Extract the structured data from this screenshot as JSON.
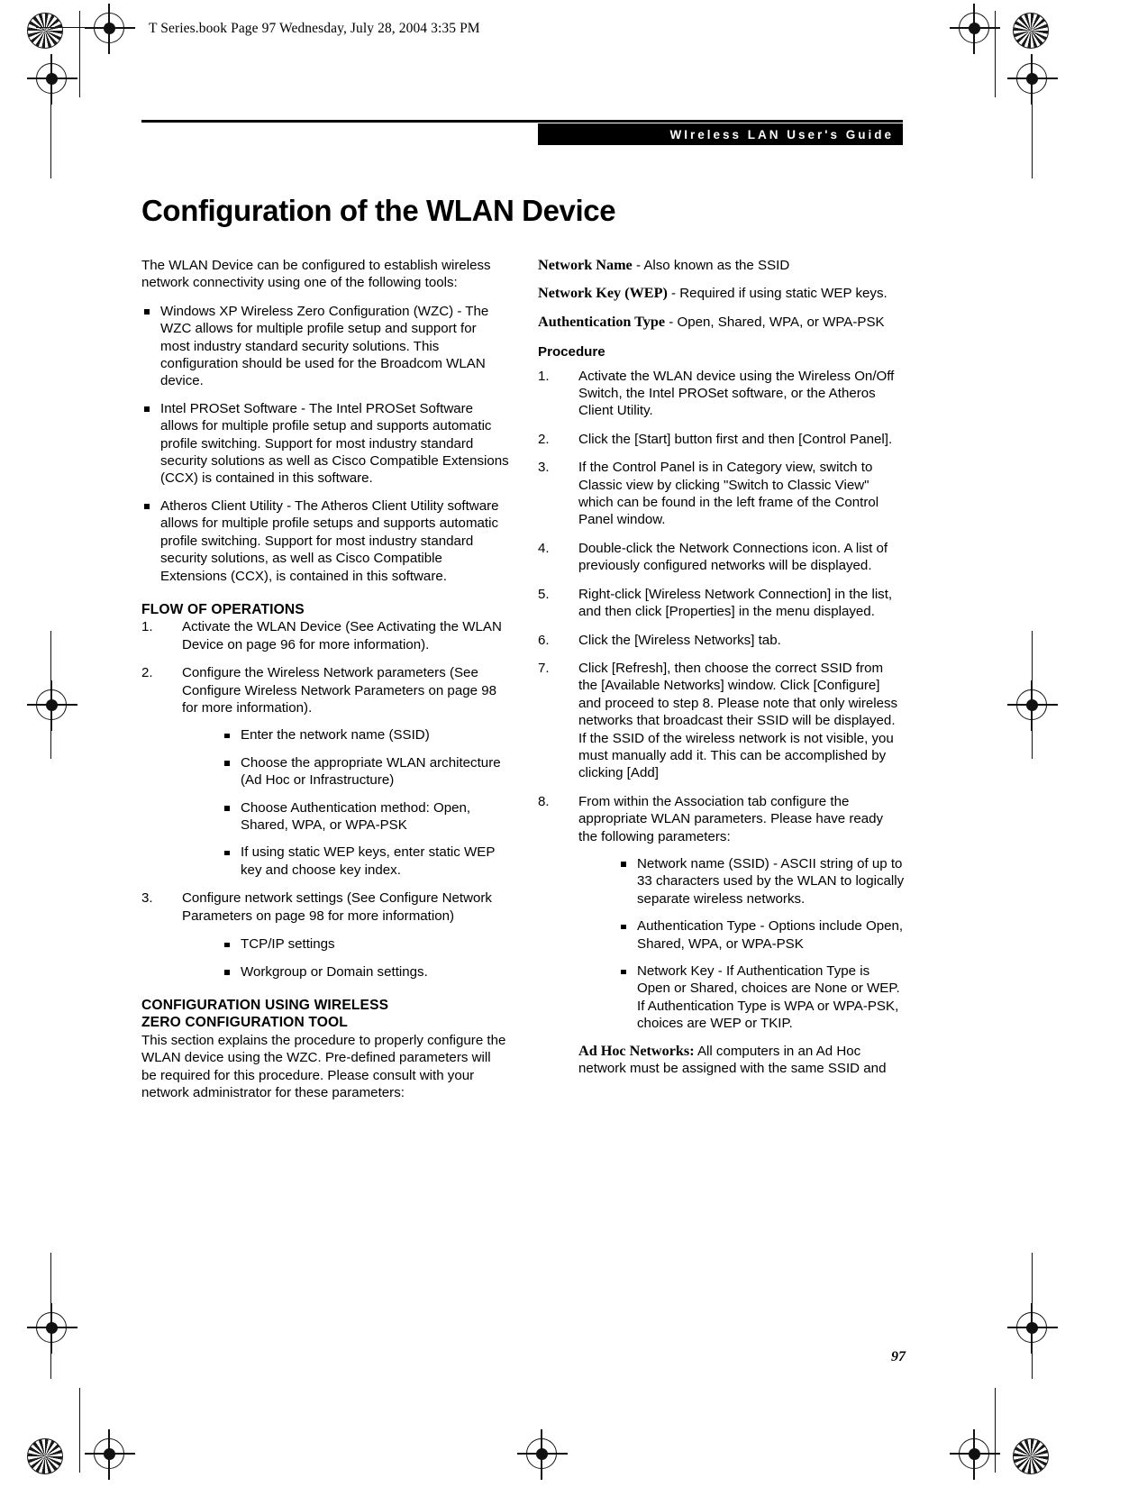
{
  "running_head": "T Series.book  Page 97  Wednesday, July 28, 2004  3:35 PM",
  "banner": {
    "label": "WIreless LAN User's Guide"
  },
  "page_title": "Configuration of the WLAN Device",
  "page_number": "97",
  "left_column": {
    "intro": "The WLAN Device can be configured to establish wireless network connectivity using one of the following tools:",
    "tool_bullets": [
      "Windows XP Wireless Zero Configuration (WZC) - The WZC allows for multiple profile setup and support for most industry standard security solutions. This configuration should be used for the Broadcom WLAN device.",
      "Intel PROSet Software - The Intel PROSet Software allows for multiple profile setup and supports automatic profile switching. Support for most industry standard security solutions as well as Cisco Compatible Extensions (CCX) is contained in this software.",
      "Atheros Client Utility - The Atheros Client Utility software allows for multiple profile setups and supports automatic profile switching. Support for most industry standard security solutions, as well as Cisco Compatible Extensions (CCX), is contained in this software."
    ],
    "flow_heading": "FLOW OF OPERATIONS",
    "flow_steps": [
      {
        "num": "1.",
        "text": "Activate the WLAN Device (See Activating the WLAN Device on page 96 for more information)."
      },
      {
        "num": "2.",
        "text": "Configure the Wireless Network parameters (See Configure Wireless Network Parameters on page 98 for more information)."
      },
      {
        "num": "3.",
        "text": "Configure network settings (See Configure Network Parameters on page 98 for more information)"
      }
    ],
    "step2_bullets": [
      "Enter the network name (SSID)",
      "Choose the appropriate WLAN architecture (Ad Hoc or Infrastructure)",
      "Choose Authentication method: Open, Shared, WPA, or WPA-PSK",
      "If using static WEP keys, enter static WEP key and choose key index."
    ],
    "step3_bullets": [
      "TCP/IP settings",
      "Workgroup or Domain settings."
    ],
    "wzc_heading_line1": "CONFIGURATION USING WIRELESS",
    "wzc_heading_line2": "ZERO CONFIGURATION TOOL",
    "wzc_paragraph": "This section explains the procedure to properly configure the WLAN device using the WZC. Pre-defined parameters will be required for this procedure. Please consult with your network administrator for these parameters:"
  },
  "right_column": {
    "definitions": [
      {
        "term": "Network Name",
        "rest": " - Also known as the SSID"
      },
      {
        "term": "Network Key (WEP)",
        "rest": " - Required if using static WEP keys."
      },
      {
        "term": "Authentication Type",
        "rest": " - Open, Shared, WPA, or WPA-PSK"
      }
    ],
    "procedure_heading": "Procedure",
    "procedure_steps": [
      {
        "num": "1.",
        "text": "Activate the WLAN device using the Wireless On/Off Switch, the Intel PROSet software, or the Atheros Client Utility."
      },
      {
        "num": "2.",
        "text": "Click the [Start] button first and then [Control Panel]."
      },
      {
        "num": "3.",
        "text": "If the Control Panel is in Category view, switch to Classic view by clicking \"Switch to Classic View\" which can be found in the left frame of the Control Panel window."
      },
      {
        "num": "4.",
        "text": "Double-click the Network Connections icon. A list of previously configured networks will be displayed."
      },
      {
        "num": "5.",
        "text": "Right-click [Wireless Network Connection] in the list, and then click [Properties] in the menu displayed."
      },
      {
        "num": "6.",
        "text": "Click the [Wireless Networks] tab."
      },
      {
        "num": "7.",
        "text": "Click [Refresh], then choose the correct SSID from the [Available Networks] window. Click [Configure] and proceed to step 8. Please note that only wireless networks that broadcast their SSID will be displayed. If the SSID of the wireless network is not visible, you must manually add it. This can be accomplished by clicking [Add]"
      },
      {
        "num": "8.",
        "text": "From within the Association tab configure the appropriate WLAN parameters. Please have ready the following parameters:"
      }
    ],
    "step8_bullets": [
      "Network name (SSID) - ASCII string of up to 33 characters used by the WLAN to logically separate wireless networks.",
      "Authentication Type - Options include Open, Shared, WPA, or WPA-PSK",
      "Network Key - If Authentication Type is Open or Shared, choices are None or WEP. If Authentication Type is WPA or WPA-PSK, choices are WEP or TKIP."
    ],
    "adhoc_note": {
      "term": "Ad Hoc Networks:",
      "rest": " All computers in an Ad Hoc network must be assigned with the same SSID and"
    }
  }
}
